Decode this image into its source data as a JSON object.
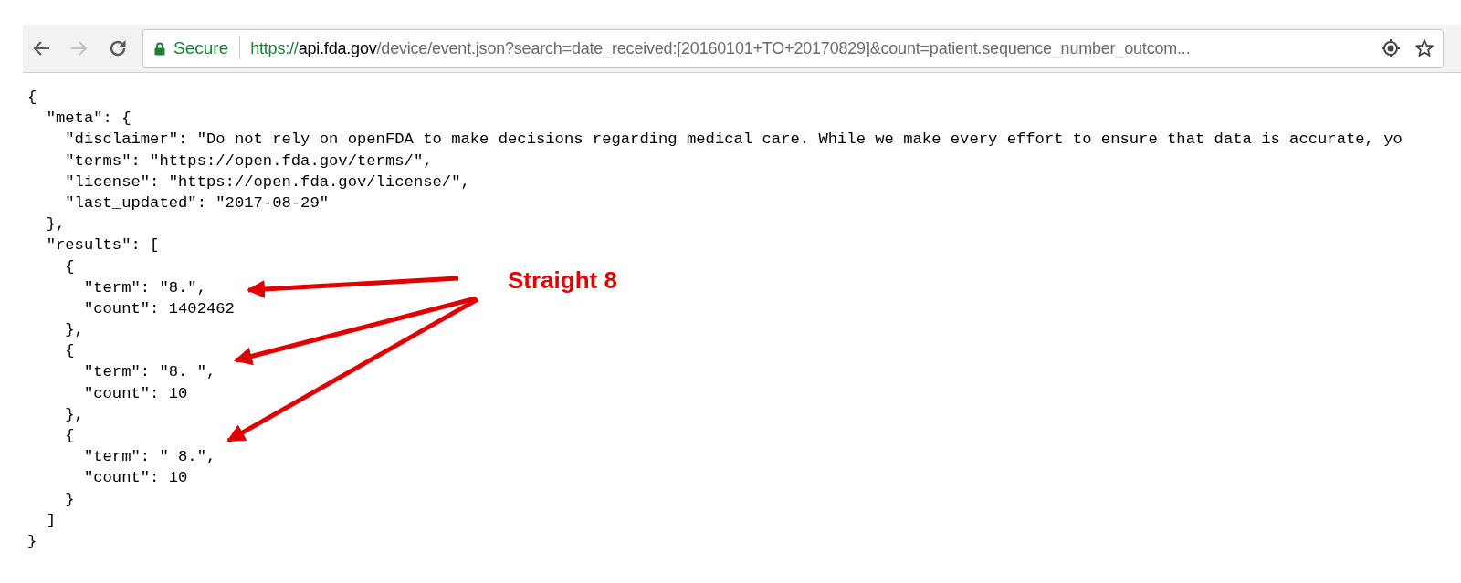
{
  "address_bar": {
    "security_label": "Secure",
    "url_scheme": "https://",
    "url_host": "api.fda.gov",
    "url_rest": "/device/event.json?search=date_received:[20160101+TO+20170829]&count=patient.sequence_number_outcom..."
  },
  "document": {
    "lines": [
      "{",
      "  \"meta\": {",
      "    \"disclaimer\": \"Do not rely on openFDA to make decisions regarding medical care. While we make every effort to ensure that data is accurate, yo",
      "    \"terms\": \"https://open.fda.gov/terms/\",",
      "    \"license\": \"https://open.fda.gov/license/\",",
      "    \"last_updated\": \"2017-08-29\"",
      "  },",
      "  \"results\": [",
      "    {",
      "      \"term\": \"8.\",",
      "      \"count\": 1402462",
      "    },",
      "    {",
      "      \"term\": \"8. \",",
      "      \"count\": 10",
      "    },",
      "    {",
      "      \"term\": \" 8.\",",
      "      \"count\": 10",
      "    }",
      "  ]",
      "}"
    ]
  },
  "annotation": {
    "label": "Straight 8"
  }
}
